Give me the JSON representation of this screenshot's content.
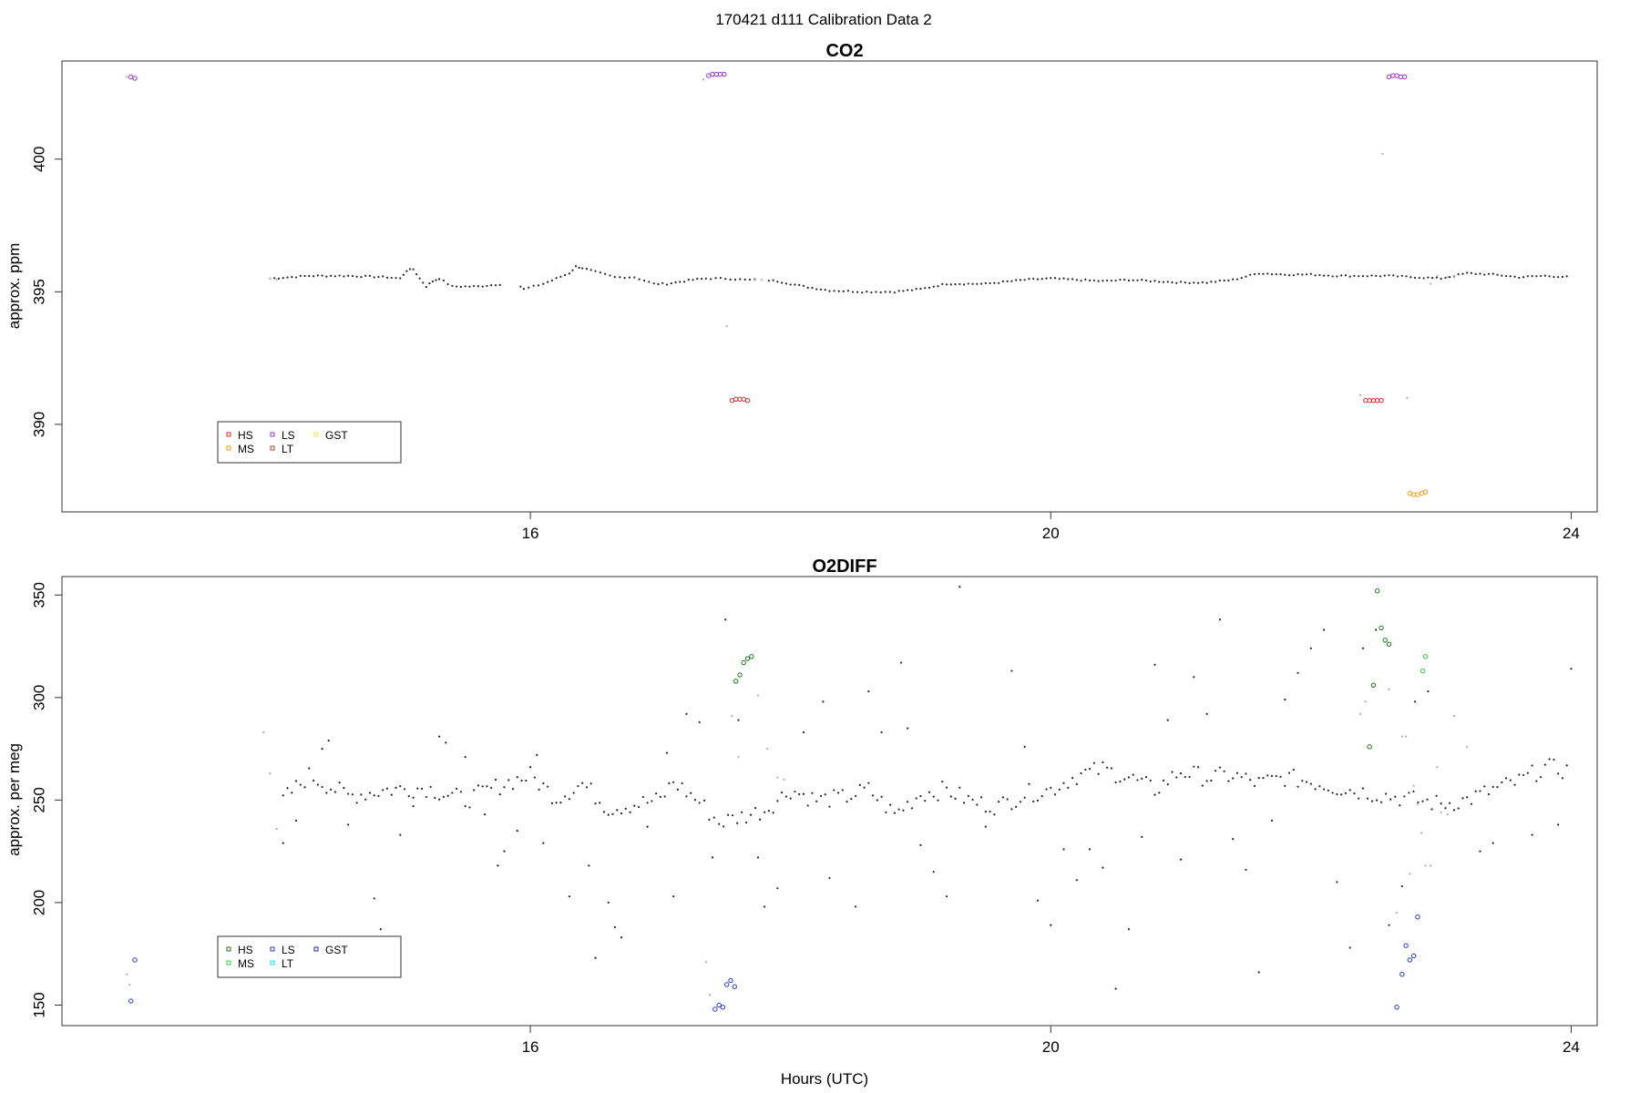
{
  "title": "170421   d111   Calibration Data 2",
  "xlabel": "Hours (UTC)",
  "colors": {
    "HS": "#d62828",
    "MS": "#f39c12",
    "LS": "#9b30d9",
    "LT": "#c0392b",
    "GST": "#f2e64d",
    "sample": "#222222",
    "flush": "#b5b5b5"
  },
  "chart_data": [
    {
      "type": "scatter",
      "title": "CO2",
      "ylabel": "approx. ppm",
      "xlim": [
        12.4,
        24.2
      ],
      "ylim": [
        386.7,
        403.7
      ],
      "x_ticks": [
        16,
        20,
        24
      ],
      "y_ticks": [
        390,
        395,
        400
      ],
      "legend": {
        "placement": "bottom-left",
        "entries": [
          "HS",
          "MS",
          "LS",
          "LT",
          "GST"
        ],
        "colors": [
          "#d62828",
          "#f39c12",
          "#9b30d9",
          "#c0392b",
          "#f2e64d"
        ]
      },
      "series": [
        {
          "key": "HS",
          "points": [
            [
              17.55,
              390.9
            ],
            [
              17.58,
              390.95
            ],
            [
              17.61,
              390.95
            ],
            [
              17.64,
              390.95
            ],
            [
              17.67,
              390.9
            ],
            [
              22.42,
              390.9
            ],
            [
              22.45,
              390.9
            ],
            [
              22.48,
              390.9
            ],
            [
              22.51,
              390.9
            ],
            [
              22.54,
              390.9
            ]
          ]
        },
        {
          "key": "LS",
          "points": [
            [
              12.93,
              403.1
            ],
            [
              12.96,
              403.05
            ],
            [
              17.37,
              403.15
            ],
            [
              17.4,
              403.2
            ],
            [
              17.43,
              403.2
            ],
            [
              17.46,
              403.2
            ],
            [
              17.49,
              403.2
            ],
            [
              22.6,
              403.1
            ],
            [
              22.63,
              403.15
            ],
            [
              22.66,
              403.15
            ],
            [
              22.69,
              403.1
            ],
            [
              22.72,
              403.1
            ]
          ]
        },
        {
          "key": "MS",
          "points": [
            [
              22.76,
              387.4
            ],
            [
              22.79,
              387.35
            ],
            [
              22.82,
              387.35
            ],
            [
              22.85,
              387.4
            ],
            [
              22.88,
              387.45
            ]
          ]
        },
        {
          "key": "flush",
          "points": [
            [
              12.9,
              403.1
            ],
            [
              14.0,
              395.5
            ],
            [
              14.05,
              395.45
            ],
            [
              17.33,
              403.0
            ],
            [
              17.51,
              393.7
            ],
            [
              17.73,
              395.45
            ],
            [
              17.78,
              395.45
            ],
            [
              22.38,
              391.1
            ],
            [
              22.55,
              400.2
            ],
            [
              22.74,
              391.0
            ],
            [
              22.92,
              395.3
            ],
            [
              22.97,
              395.6
            ],
            [
              23.05,
              395.55
            ],
            [
              23.1,
              395.55
            ]
          ]
        }
      ],
      "sample_trace": [
        [
          14.0,
          395.5
        ],
        [
          14.3,
          395.6
        ],
        [
          14.6,
          395.6
        ],
        [
          14.9,
          395.55
        ],
        [
          15.0,
          395.5
        ],
        [
          15.05,
          395.8
        ],
        [
          15.1,
          395.85
        ],
        [
          15.15,
          395.5
        ],
        [
          15.2,
          395.2
        ],
        [
          15.25,
          395.4
        ],
        [
          15.3,
          395.5
        ],
        [
          15.4,
          395.2
        ],
        [
          15.6,
          395.2
        ],
        [
          15.8,
          395.3
        ],
        [
          15.9,
          395.3
        ],
        [
          15.95,
          395.1
        ],
        [
          16.1,
          395.3
        ],
        [
          16.2,
          395.5
        ],
        [
          16.3,
          395.7
        ],
        [
          16.35,
          395.95
        ],
        [
          16.4,
          395.9
        ],
        [
          16.5,
          395.75
        ],
        [
          16.65,
          395.55
        ],
        [
          16.8,
          395.55
        ],
        [
          16.95,
          395.3
        ],
        [
          17.05,
          395.3
        ],
        [
          17.25,
          395.45
        ],
        [
          17.35,
          395.5
        ],
        [
          17.5,
          395.5
        ],
        [
          17.65,
          395.45
        ],
        [
          17.8,
          395.45
        ],
        [
          17.9,
          395.4
        ],
        [
          18.1,
          395.2
        ],
        [
          18.3,
          395.05
        ],
        [
          18.55,
          395.0
        ],
        [
          18.8,
          395.0
        ],
        [
          19.0,
          395.1
        ],
        [
          19.1,
          395.2
        ],
        [
          19.2,
          395.3
        ],
        [
          19.3,
          395.3
        ],
        [
          19.5,
          395.3
        ],
        [
          19.8,
          395.45
        ],
        [
          20.0,
          395.5
        ],
        [
          20.2,
          395.45
        ],
        [
          20.4,
          395.4
        ],
        [
          20.6,
          395.45
        ],
        [
          20.8,
          395.4
        ],
        [
          21.0,
          395.35
        ],
        [
          21.2,
          395.35
        ],
        [
          21.4,
          395.45
        ],
        [
          21.6,
          395.7
        ],
        [
          21.8,
          395.65
        ],
        [
          22.0,
          395.65
        ],
        [
          22.2,
          395.6
        ],
        [
          22.4,
          395.6
        ],
        [
          22.6,
          395.6
        ],
        [
          22.8,
          395.55
        ],
        [
          23.0,
          395.5
        ],
        [
          23.2,
          395.7
        ],
        [
          23.4,
          395.65
        ],
        [
          23.6,
          395.55
        ],
        [
          23.8,
          395.6
        ],
        [
          24.0,
          395.55
        ]
      ],
      "gaps": [
        [
          15.78,
          15.92
        ],
        [
          17.76,
          17.82
        ]
      ]
    },
    {
      "type": "scatter",
      "title": "O2DIFF",
      "ylabel": "approx. per meg",
      "xlim": [
        12.4,
        24.2
      ],
      "ylim": [
        140,
        359
      ],
      "x_ticks": [
        16,
        20,
        24
      ],
      "y_ticks": [
        150,
        200,
        250,
        300,
        350
      ],
      "legend": {
        "placement": "bottom-left",
        "entries": [
          "HS",
          "MS",
          "LS",
          "LT",
          "GST"
        ],
        "colors": [
          "#1a7a1a",
          "#2ecc40",
          "#1f3bd6",
          "#00e5e5",
          "#2020c0"
        ]
      },
      "series": [
        {
          "key": "HS",
          "color": "#1a7a1a",
          "points": [
            [
              17.58,
              308
            ],
            [
              17.61,
              311
            ],
            [
              17.64,
              317
            ],
            [
              17.67,
              319
            ],
            [
              17.7,
              320
            ],
            [
              22.45,
              276
            ],
            [
              22.48,
              306
            ],
            [
              22.51,
              352
            ],
            [
              22.54,
              334
            ],
            [
              22.57,
              328
            ],
            [
              22.6,
              326
            ]
          ]
        },
        {
          "key": "MS",
          "color": "#2ecc40",
          "points": [
            [
              22.88,
              320
            ],
            [
              22.86,
              313
            ]
          ]
        },
        {
          "key": "LS",
          "color": "#1f3bd6",
          "points": [
            [
              12.96,
              172
            ],
            [
              12.93,
              152
            ],
            [
              17.42,
              148
            ],
            [
              17.45,
              150
            ],
            [
              17.48,
              149
            ],
            [
              17.51,
              160
            ],
            [
              17.54,
              162
            ],
            [
              17.57,
              159
            ],
            [
              22.66,
              149
            ],
            [
              22.7,
              165
            ],
            [
              22.73,
              179
            ],
            [
              22.76,
              172
            ],
            [
              22.79,
              174
            ],
            [
              22.82,
              193
            ]
          ]
        },
        {
          "key": "flush",
          "color": "#b5b5b5",
          "points": [
            [
              12.9,
              165
            ],
            [
              12.92,
              160
            ],
            [
              13.95,
              283
            ],
            [
              14.0,
              263
            ],
            [
              14.05,
              236
            ],
            [
              17.35,
              171
            ],
            [
              17.38,
              155
            ],
            [
              17.55,
              291
            ],
            [
              17.6,
              271
            ],
            [
              17.75,
              301
            ],
            [
              17.82,
              275
            ],
            [
              17.9,
              261
            ],
            [
              17.95,
              260
            ],
            [
              22.38,
              292
            ],
            [
              22.42,
              298
            ],
            [
              22.6,
              304
            ],
            [
              22.66,
              195
            ],
            [
              22.7,
              281
            ],
            [
              22.73,
              281
            ],
            [
              22.76,
              214
            ],
            [
              22.79,
              257
            ],
            [
              22.82,
              248
            ],
            [
              22.85,
              234
            ],
            [
              22.88,
              218
            ],
            [
              22.92,
              218
            ],
            [
              22.97,
              266
            ],
            [
              23.0,
              244
            ],
            [
              23.05,
              243
            ],
            [
              23.1,
              291
            ],
            [
              23.2,
              276
            ]
          ]
        }
      ],
      "sample_trace": [
        [
          14.1,
          250
        ],
        [
          14.3,
          262
        ],
        [
          14.6,
          252
        ],
        [
          14.9,
          255
        ],
        [
          15.2,
          256
        ],
        [
          15.5,
          250
        ],
        [
          15.8,
          258
        ],
        [
          16.0,
          262
        ],
        [
          16.2,
          251
        ],
        [
          16.4,
          258
        ],
        [
          16.6,
          246
        ],
        [
          16.8,
          248
        ],
        [
          17.0,
          250
        ],
        [
          17.1,
          259
        ],
        [
          17.3,
          249
        ],
        [
          17.45,
          239
        ],
        [
          17.8,
          245
        ],
        [
          18.0,
          255
        ],
        [
          18.2,
          250
        ],
        [
          18.4,
          251
        ],
        [
          18.6,
          255
        ],
        [
          18.8,
          243
        ],
        [
          19.0,
          253
        ],
        [
          19.2,
          255
        ],
        [
          19.4,
          249
        ],
        [
          19.6,
          247
        ],
        [
          19.8,
          253
        ],
        [
          20.0,
          255
        ],
        [
          20.2,
          262
        ],
        [
          20.4,
          265
        ],
        [
          20.6,
          261
        ],
        [
          20.8,
          255
        ],
        [
          21.0,
          264
        ],
        [
          21.2,
          261
        ],
        [
          21.4,
          262
        ],
        [
          21.6,
          258
        ],
        [
          21.8,
          261
        ],
        [
          22.0,
          259
        ],
        [
          22.2,
          256
        ],
        [
          22.4,
          254
        ],
        [
          23.0,
          248
        ],
        [
          23.2,
          250
        ],
        [
          23.4,
          255
        ],
        [
          23.6,
          259
        ],
        [
          23.8,
          266
        ],
        [
          24.0,
          264
        ]
      ],
      "outliers": [
        [
          14.1,
          229
        ],
        [
          14.2,
          240
        ],
        [
          14.4,
          275
        ],
        [
          14.45,
          279
        ],
        [
          14.6,
          238
        ],
        [
          14.8,
          202
        ],
        [
          14.85,
          187
        ],
        [
          15.0,
          233
        ],
        [
          15.1,
          247
        ],
        [
          15.3,
          281
        ],
        [
          15.35,
          278
        ],
        [
          15.5,
          271
        ],
        [
          15.65,
          243
        ],
        [
          15.75,
          218
        ],
        [
          15.8,
          225
        ],
        [
          15.9,
          235
        ],
        [
          16.05,
          272
        ],
        [
          16.1,
          229
        ],
        [
          16.3,
          203
        ],
        [
          16.45,
          218
        ],
        [
          16.5,
          173
        ],
        [
          16.6,
          200
        ],
        [
          16.65,
          188
        ],
        [
          16.7,
          183
        ],
        [
          16.9,
          237
        ],
        [
          17.05,
          273
        ],
        [
          17.1,
          203
        ],
        [
          17.2,
          292
        ],
        [
          17.3,
          288
        ],
        [
          17.4,
          222
        ],
        [
          17.5,
          338
        ],
        [
          17.6,
          289
        ],
        [
          17.75,
          222
        ],
        [
          17.8,
          198
        ],
        [
          17.9,
          207
        ],
        [
          18.1,
          283
        ],
        [
          18.25,
          298
        ],
        [
          18.3,
          212
        ],
        [
          18.5,
          198
        ],
        [
          18.6,
          303
        ],
        [
          18.7,
          283
        ],
        [
          18.85,
          317
        ],
        [
          18.9,
          285
        ],
        [
          19.0,
          228
        ],
        [
          19.1,
          215
        ],
        [
          19.2,
          203
        ],
        [
          19.3,
          354
        ],
        [
          19.5,
          237
        ],
        [
          19.7,
          313
        ],
        [
          19.8,
          276
        ],
        [
          19.9,
          201
        ],
        [
          20.0,
          189
        ],
        [
          20.1,
          226
        ],
        [
          20.2,
          211
        ],
        [
          20.3,
          226
        ],
        [
          20.4,
          217
        ],
        [
          20.5,
          158
        ],
        [
          20.6,
          187
        ],
        [
          20.7,
          232
        ],
        [
          20.8,
          316
        ],
        [
          20.9,
          289
        ],
        [
          21.0,
          221
        ],
        [
          21.1,
          310
        ],
        [
          21.2,
          292
        ],
        [
          21.3,
          338
        ],
        [
          21.4,
          231
        ],
        [
          21.5,
          216
        ],
        [
          21.6,
          166
        ],
        [
          21.7,
          240
        ],
        [
          21.8,
          299
        ],
        [
          21.9,
          312
        ],
        [
          22.0,
          324
        ],
        [
          22.1,
          333
        ],
        [
          22.2,
          210
        ],
        [
          22.3,
          178
        ],
        [
          22.4,
          324
        ],
        [
          22.5,
          333
        ],
        [
          22.6,
          189
        ],
        [
          22.7,
          208
        ],
        [
          22.8,
          298
        ],
        [
          22.9,
          303
        ],
        [
          23.3,
          225
        ],
        [
          23.4,
          229
        ],
        [
          23.7,
          233
        ],
        [
          23.9,
          238
        ],
        [
          24.0,
          314
        ]
      ]
    }
  ]
}
